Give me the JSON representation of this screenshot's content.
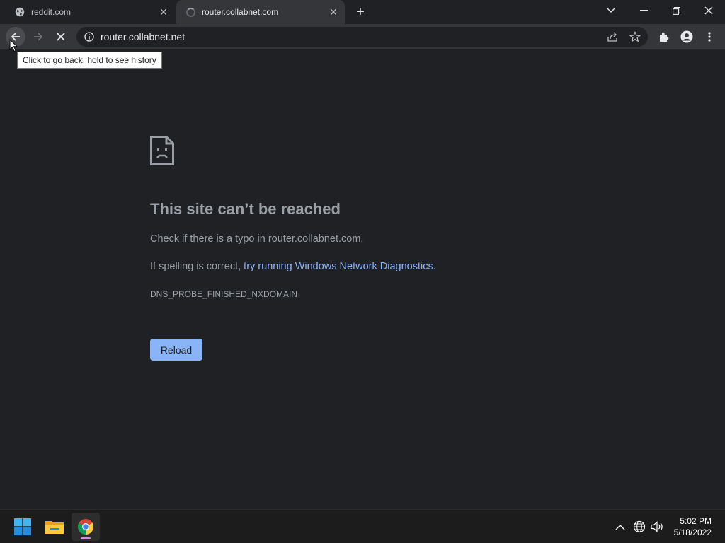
{
  "browser": {
    "tabs": [
      {
        "title": "reddit.com",
        "active": false
      },
      {
        "title": "router.collabnet.com",
        "active": true
      }
    ],
    "new_tab_label": "+",
    "address": "router.collabnet.net",
    "tooltip": "Click to go back, hold to see history"
  },
  "error_page": {
    "title": "This site can’t be reached",
    "line1": "Check if there is a typo in router.collabnet.com.",
    "line2_prefix": "If spelling is correct, ",
    "line2_link": "try running Windows Network Diagnostics",
    "line2_suffix": ".",
    "error_code": "DNS_PROBE_FINISHED_NXDOMAIN",
    "reload_label": "Reload"
  },
  "taskbar": {
    "apps": [
      "start-icon",
      "file-explorer-icon",
      "chrome-icon"
    ],
    "time": "5:02 PM",
    "date": "5/18/2022"
  },
  "colors": {
    "page_bg": "#202124",
    "toolbar_bg": "#35363a",
    "link": "#8ab4f8",
    "button": "#8ab4f8"
  }
}
